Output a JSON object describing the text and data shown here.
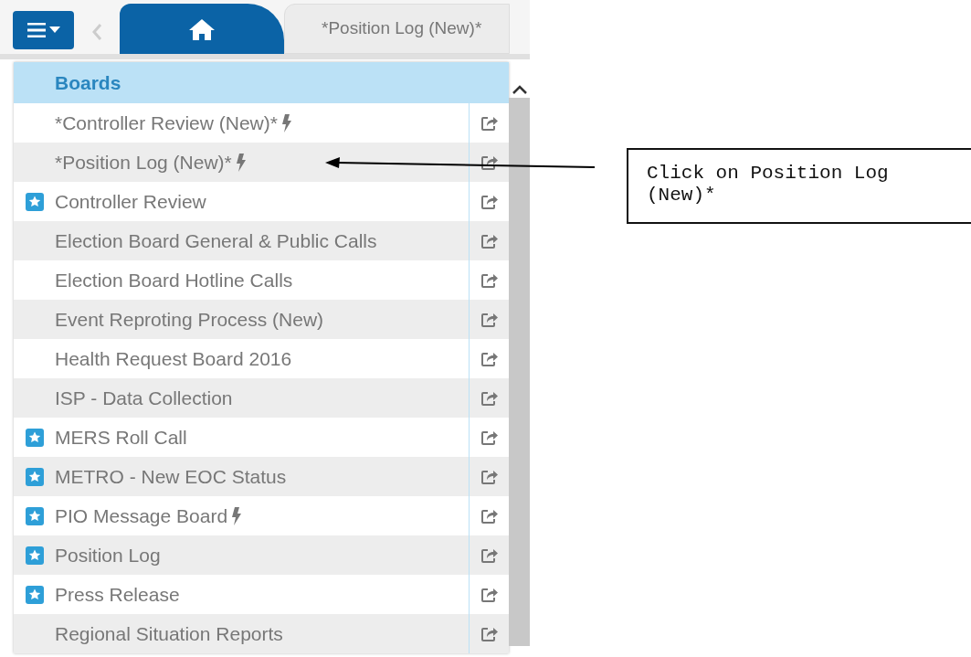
{
  "tabs": [
    {
      "kind": "home",
      "selected": true
    },
    {
      "kind": "text",
      "label": "*Position Log (New)*",
      "selected": false
    }
  ],
  "menu": {
    "header": "Boards",
    "items": [
      {
        "label": "*Controller Review (New)*",
        "favorite": false,
        "lightning": true
      },
      {
        "label": "*Position Log (New)*",
        "favorite": false,
        "lightning": true
      },
      {
        "label": "Controller Review",
        "favorite": true,
        "lightning": false
      },
      {
        "label": "Election Board General & Public Calls",
        "favorite": false,
        "lightning": false
      },
      {
        "label": "Election Board Hotline Calls",
        "favorite": false,
        "lightning": false
      },
      {
        "label": "Event Reproting Process (New)",
        "favorite": false,
        "lightning": false
      },
      {
        "label": "Health Request Board 2016",
        "favorite": false,
        "lightning": false
      },
      {
        "label": "ISP - Data Collection",
        "favorite": false,
        "lightning": false
      },
      {
        "label": "MERS Roll Call",
        "favorite": true,
        "lightning": false
      },
      {
        "label": "METRO - New EOC Status",
        "favorite": true,
        "lightning": false
      },
      {
        "label": "PIO Message Board",
        "favorite": true,
        "lightning": true
      },
      {
        "label": "Position Log",
        "favorite": true,
        "lightning": false
      },
      {
        "label": "Press Release",
        "favorite": true,
        "lightning": false
      },
      {
        "label": "Regional Situation Reports",
        "favorite": false,
        "lightning": false
      }
    ]
  },
  "callout": {
    "text": "Click on Position Log (New)*"
  }
}
